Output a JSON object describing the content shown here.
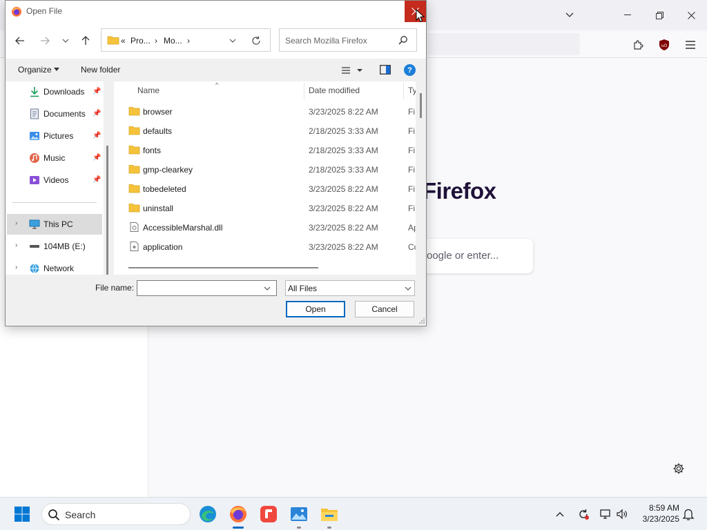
{
  "dialog": {
    "title": "Open File",
    "breadcrumb": [
      "«",
      "Pro...",
      "›",
      "Mo...",
      "›"
    ],
    "search_placeholder": "Search Mozilla Firefox",
    "organize_label": "Organize",
    "new_folder_label": "New folder",
    "help_label": "?",
    "nav_items": [
      {
        "label": "Downloads",
        "icon": "download-icon",
        "pinned": true
      },
      {
        "label": "Documents",
        "icon": "documents-icon",
        "pinned": true
      },
      {
        "label": "Pictures",
        "icon": "pictures-icon",
        "pinned": true
      },
      {
        "label": "Music",
        "icon": "music-icon",
        "pinned": true
      },
      {
        "label": "Videos",
        "icon": "videos-icon",
        "pinned": true
      },
      {
        "label": "This PC",
        "icon": "computer-icon",
        "expandable": true,
        "selected": true
      },
      {
        "label": "104MB (E:)",
        "icon": "drive-icon",
        "expandable": true
      },
      {
        "label": "Network",
        "icon": "network-icon",
        "expandable": true
      }
    ],
    "columns": {
      "name": "Name",
      "date": "Date modified",
      "type": "Ty"
    },
    "files": [
      {
        "name": "browser",
        "date": "3/23/2025 8:22 AM",
        "type": "Fi",
        "icon": "folder-icon"
      },
      {
        "name": "defaults",
        "date": "2/18/2025 3:33 AM",
        "type": "Fi",
        "icon": "folder-icon"
      },
      {
        "name": "fonts",
        "date": "2/18/2025 3:33 AM",
        "type": "Fi",
        "icon": "folder-icon"
      },
      {
        "name": "gmp-clearkey",
        "date": "2/18/2025 3:33 AM",
        "type": "Fi",
        "icon": "folder-icon"
      },
      {
        "name": "tobedeleted",
        "date": "3/23/2025 8:22 AM",
        "type": "Fi",
        "icon": "folder-icon"
      },
      {
        "name": "uninstall",
        "date": "3/23/2025 8:22 AM",
        "type": "Fi",
        "icon": "folder-icon"
      },
      {
        "name": "AccessibleMarshal.dll",
        "date": "3/23/2025 8:22 AM",
        "type": "Ap",
        "icon": "dll-file-icon"
      },
      {
        "name": "application",
        "date": "3/23/2025 8:22 AM",
        "type": "Cc",
        "icon": "config-file-icon"
      }
    ],
    "file_name_label": "File name:",
    "file_name_value": "",
    "filter_value": "All Files",
    "open_label": "Open",
    "cancel_label": "Cancel"
  },
  "firefox": {
    "brand_text": "Firefox",
    "search_placeholder": "oogle or enter..."
  },
  "taskbar": {
    "search_label": "Search",
    "time": "8:59 AM",
    "date": "3/23/2025",
    "apps": [
      "edge-icon",
      "firefox-icon",
      "red-app-icon",
      "photos-icon",
      "file-explorer-icon"
    ]
  },
  "colors": {
    "close_red": "#c42b1c",
    "accent_blue": "#0067c0",
    "folder_yellow": "#f5c33b",
    "selection_gray": "#dcdcdc"
  }
}
